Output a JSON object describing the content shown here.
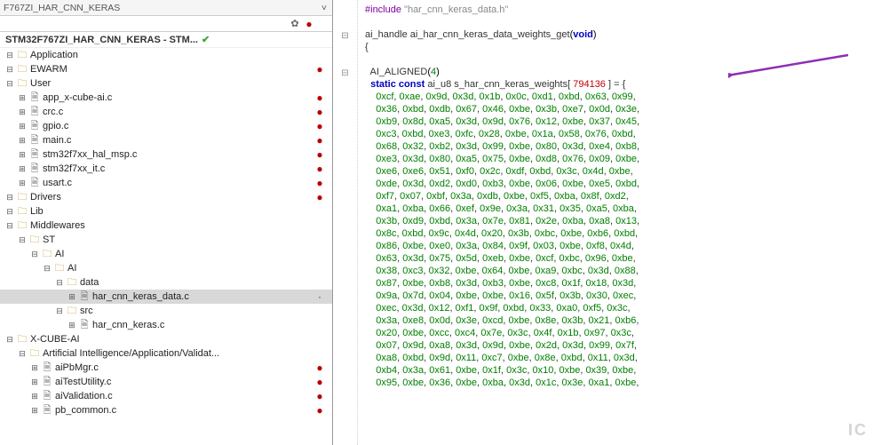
{
  "tab_title": "F767ZI_HAR_CNN_KERAS",
  "project_title": "STM32F767ZI_HAR_CNN_KERAS - STM...",
  "tree": [
    {
      "lv": 0,
      "exp": "-",
      "ico": "folder",
      "lbl": "Application",
      "mk": ""
    },
    {
      "lv": 0,
      "exp": "-",
      "ico": "folder",
      "lbl": "EWARM",
      "mk": "●"
    },
    {
      "lv": 0,
      "exp": "-",
      "ico": "folder",
      "lbl": "User",
      "mk": ""
    },
    {
      "lv": 1,
      "exp": "+",
      "ico": "file",
      "lbl": "app_x-cube-ai.c",
      "mk": "●"
    },
    {
      "lv": 1,
      "exp": "+",
      "ico": "file",
      "lbl": "crc.c",
      "mk": "●"
    },
    {
      "lv": 1,
      "exp": "+",
      "ico": "file",
      "lbl": "gpio.c",
      "mk": "●"
    },
    {
      "lv": 1,
      "exp": "+",
      "ico": "file",
      "lbl": "main.c",
      "mk": "●"
    },
    {
      "lv": 1,
      "exp": "+",
      "ico": "file",
      "lbl": "stm32f7xx_hal_msp.c",
      "mk": "●"
    },
    {
      "lv": 1,
      "exp": "+",
      "ico": "file",
      "lbl": "stm32f7xx_it.c",
      "mk": "●"
    },
    {
      "lv": 1,
      "exp": "+",
      "ico": "file",
      "lbl": "usart.c",
      "mk": "●"
    },
    {
      "lv": 0,
      "exp": "-",
      "ico": "folder",
      "lbl": "Drivers",
      "mk": "●"
    },
    {
      "lv": 0,
      "exp": "-",
      "ico": "folder",
      "lbl": "Lib",
      "mk": ""
    },
    {
      "lv": 0,
      "exp": "-",
      "ico": "folder",
      "lbl": "Middlewares",
      "mk": ""
    },
    {
      "lv": 1,
      "exp": "-",
      "ico": "folder",
      "lbl": "ST",
      "mk": ""
    },
    {
      "lv": 2,
      "exp": "-",
      "ico": "folder",
      "lbl": "AI",
      "mk": ""
    },
    {
      "lv": 3,
      "exp": "-",
      "ico": "folder",
      "lbl": "AI",
      "mk": ""
    },
    {
      "lv": 4,
      "exp": "-",
      "ico": "folder",
      "lbl": "data",
      "mk": ""
    },
    {
      "lv": 5,
      "exp": "+",
      "ico": "file",
      "lbl": "har_cnn_keras_data.c",
      "mk": "·",
      "sel": 1
    },
    {
      "lv": 4,
      "exp": "-",
      "ico": "folder",
      "lbl": "src",
      "mk": ""
    },
    {
      "lv": 5,
      "exp": "+",
      "ico": "file",
      "lbl": "har_cnn_keras.c",
      "mk": ""
    },
    {
      "lv": 0,
      "exp": "-",
      "ico": "folder",
      "lbl": "X-CUBE-AI",
      "mk": ""
    },
    {
      "lv": 1,
      "exp": "-",
      "ico": "folder",
      "lbl": "Artificial Intelligence/Application/Validat...",
      "mk": ""
    },
    {
      "lv": 2,
      "exp": "+",
      "ico": "file",
      "lbl": "aiPbMgr.c",
      "mk": "●"
    },
    {
      "lv": 2,
      "exp": "+",
      "ico": "file",
      "lbl": "aiTestUtility.c",
      "mk": "●"
    },
    {
      "lv": 2,
      "exp": "+",
      "ico": "file",
      "lbl": "aiValidation.c",
      "mk": "●"
    },
    {
      "lv": 2,
      "exp": "+",
      "ico": "file",
      "lbl": "pb_common.c",
      "mk": "●"
    }
  ],
  "code": {
    "include": "#include \"har_cnn_keras_data.h\"",
    "func_sig": "ai_handle ai_har_cnn_keras_data_weights_get(void)",
    "brace": "{",
    "aligned": "  AI_ALIGNED(4)",
    "decl_prefix": "  static const ",
    "decl_type": "ai_u8",
    "decl_name": " s_har_cnn_keras_weights[ ",
    "decl_size": "794136",
    "decl_suffix": " ] = {",
    "hex_lines": [
      "0xcf, 0xae, 0x9d, 0x3d, 0x1b, 0x0c, 0xd1, 0xbd, 0x63, 0x99,",
      "0x36, 0xbd, 0xdb, 0x67, 0x46, 0xbe, 0x3b, 0xe7, 0x0d, 0x3e,",
      "0xb9, 0x8d, 0xa5, 0x3d, 0x9d, 0x76, 0x12, 0xbe, 0x37, 0x45,",
      "0xc3, 0xbd, 0xe3, 0xfc, 0x28, 0xbe, 0x1a, 0x58, 0x76, 0xbd,",
      "0x68, 0x32, 0xb2, 0x3d, 0x99, 0xbe, 0x80, 0x3d, 0xe4, 0xb8,",
      "0xe3, 0x3d, 0x80, 0xa5, 0x75, 0xbe, 0xd8, 0x76, 0x09, 0xbe,",
      "0xe6, 0xe6, 0x51, 0xf0, 0x2c, 0xdf, 0xbd, 0x3c, 0x4d, 0xbe,",
      "0xde, 0x3d, 0xd2, 0xd0, 0xb3, 0xbe, 0x06, 0xbe, 0xe5, 0xbd,",
      "0xf7, 0x07, 0xbf, 0x3a, 0xdb, 0xbe, 0xf5, 0xba, 0x8f, 0xd2,",
      "0xa1, 0xba, 0x66, 0xef, 0x9e, 0x3a, 0x31, 0x35, 0xa5, 0xba,",
      "0x3b, 0xd9, 0xbd, 0x3a, 0x7e, 0x81, 0x2e, 0xba, 0xa8, 0x13,",
      "0x8c, 0xbd, 0x9c, 0x4d, 0x20, 0x3b, 0xbc, 0xbe, 0xb6, 0xbd,",
      "0x86, 0xbe, 0xe0, 0x3a, 0x84, 0x9f, 0x03, 0xbe, 0xf8, 0x4d,",
      "0x63, 0x3d, 0x75, 0x5d, 0xeb, 0xbe, 0xcf, 0xbc, 0x96, 0xbe,",
      "0x38, 0xc3, 0x32, 0xbe, 0x64, 0xbe, 0xa9, 0xbc, 0x3d, 0x88,",
      "0x87, 0xbe, 0xb8, 0x3d, 0xb3, 0xbe, 0xc8, 0x1f, 0x18, 0x3d,",
      "0x9a, 0x7d, 0x04, 0xbe, 0xbe, 0x16, 0x5f, 0x3b, 0x30, 0xec,",
      "0xec, 0x3d, 0x12, 0xf1, 0x9f, 0xbd, 0x33, 0xa0, 0xf5, 0x3c,",
      "0x3a, 0xe8, 0x0d, 0x3e, 0xcd, 0xbe, 0x8e, 0x3b, 0x21, 0xb6,",
      "0x20, 0xbe, 0xcc, 0xc4, 0x7e, 0x3c, 0x4f, 0x1b, 0x97, 0x3c,",
      "0x07, 0x9d, 0xa8, 0x3d, 0x9d, 0xbe, 0x2d, 0x3d, 0x99, 0x7f,",
      "0xa8, 0xbd, 0x9d, 0x11, 0xc7, 0xbe, 0x8e, 0xbd, 0x11, 0x3d,",
      "0xb4, 0x3a, 0x61, 0xbe, 0x1f, 0x3c, 0x10, 0xbe, 0x39, 0xbe,",
      "0x95, 0xbe, 0x36, 0xbe, 0xba, 0x3d, 0x1c, 0x3e, 0xa1, 0xbe,"
    ]
  },
  "watermark": "IC"
}
